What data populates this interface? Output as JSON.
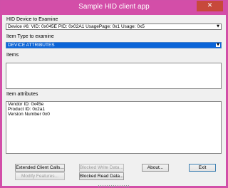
{
  "window": {
    "title": "Sample HID client app",
    "close_glyph": "✕"
  },
  "device_section": {
    "label": "HID Device to Examine",
    "selected": "Device #6: VID: 0x045E  PID: 0x02A1  UsagePage: 0x1  Usage: 0x5",
    "arrow": "▼"
  },
  "item_type_section": {
    "label": "Item Type to examine",
    "selected": "DEVICE ATTRIBUTES",
    "arrow": "▼"
  },
  "items_section": {
    "label": "Items"
  },
  "attributes_section": {
    "label": "Item attributes",
    "lines": [
      "Vendor ID: 0x45e",
      "Product ID: 0x2a1",
      "Version Number  0x0"
    ]
  },
  "buttons": {
    "extended_client_calls": "Extended Client Calls...",
    "modify_features": "Modify Features...",
    "blocked_write_data": "Blocked Write Data...",
    "blocked_read_data": "Blocked Read Data...",
    "about": "About...",
    "exit": "Exit"
  },
  "colors": {
    "title_bar": "#d34ea8",
    "close_button": "#c7493b",
    "selection": "#0a64d8"
  }
}
